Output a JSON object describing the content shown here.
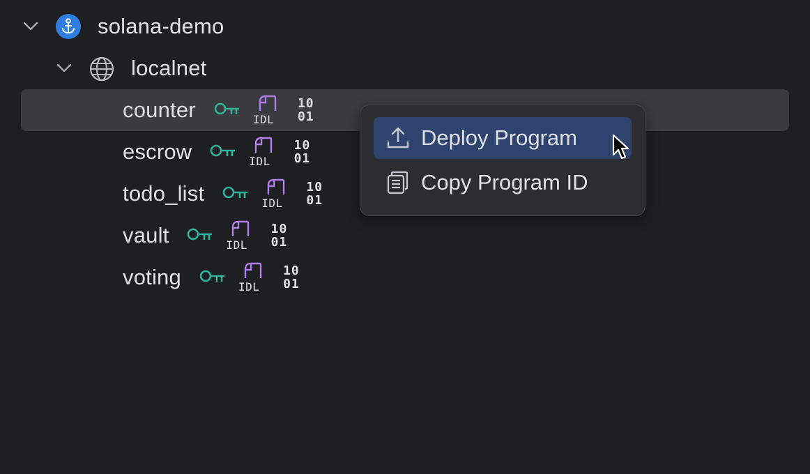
{
  "tree": {
    "project": {
      "label": "solana-demo",
      "icon": "anchor-icon",
      "expanded": true
    },
    "network": {
      "label": "localnet",
      "icon": "globe-icon",
      "expanded": true
    },
    "programs": [
      {
        "name": "counter",
        "selected": true
      },
      {
        "name": "escrow"
      },
      {
        "name": "todo_list"
      },
      {
        "name": "vault"
      },
      {
        "name": "voting"
      }
    ],
    "program_icons": {
      "idl_text": "IDL",
      "binary_text_line1": "10",
      "binary_text_line2": "01"
    }
  },
  "context_menu": {
    "items": [
      {
        "label": "Deploy Program",
        "icon": "upload-icon",
        "highlighted": true
      },
      {
        "label": "Copy Program ID",
        "icon": "copy-icon",
        "highlighted": false
      }
    ]
  },
  "colors": {
    "background": "#1e1f22",
    "selection": "#393b40",
    "menu_highlight": "#2e436e",
    "key_icon": "#2fb39a",
    "idl_icon": "#b07ee8",
    "anchor_badge": "#2f7de1"
  }
}
